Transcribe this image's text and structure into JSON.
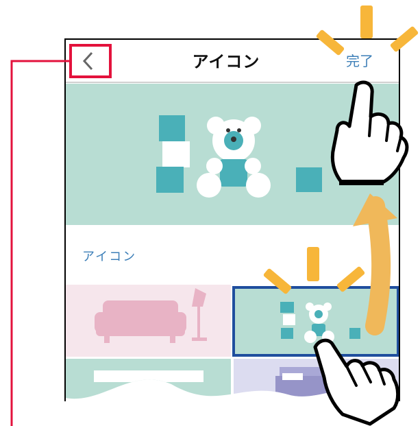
{
  "header": {
    "title": "アイコン",
    "done_label": "完了",
    "back_icon": "chevron-left-icon"
  },
  "section": {
    "label": "アイコン"
  },
  "options": [
    {
      "icon": "sofa-lamp-icon",
      "selected": false
    },
    {
      "icon": "teddy-bear-icon",
      "selected": true
    },
    {
      "icon": "whiteboard-icon",
      "selected": false
    },
    {
      "icon": "bed-icon",
      "selected": false
    }
  ],
  "colors": {
    "accent_text": "#3d7fb8",
    "preview_bg": "#b8ddd3",
    "teal": "#4ab0b8",
    "pink_bg": "#f6e6ec",
    "pink": "#e8b3c5",
    "highlight_red": "#e3123c",
    "selection_blue": "#1f4e9e",
    "sparkle": "#f7b63a",
    "arrow": "#f0b85a"
  }
}
